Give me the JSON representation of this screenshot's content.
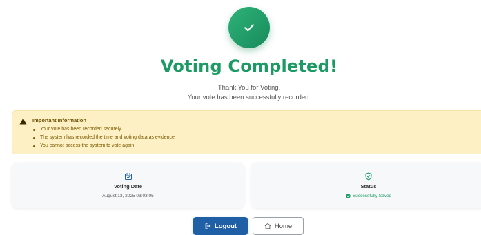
{
  "header": {
    "title": "Voting Completed!",
    "thanks": "Thank You for Voting.",
    "recorded": "Your vote has been successfully recorded."
  },
  "alert": {
    "title": "Important Information",
    "items": [
      "Your vote has been recorded securely",
      "The system has recorded the time and voting data as evidence",
      "You cannot access the system to vote again"
    ]
  },
  "cards": {
    "date_label": "Voting Date",
    "date_value": "August 13, 2025 03:03:05",
    "status_label": "Status",
    "status_value": "Successfully Saved"
  },
  "buttons": {
    "logout": "Logout",
    "home": "Home"
  },
  "icons": {
    "success": "check-icon",
    "warning": "warning-triangle-icon",
    "calendar": "calendar-check-icon",
    "shield": "shield-check-icon",
    "status": "check-circle-icon",
    "logout": "logout-icon",
    "home": "home-icon"
  },
  "colors": {
    "success": "#1b9a64",
    "primary": "#1e5fa5",
    "alert_bg": "#fdf0c4"
  }
}
